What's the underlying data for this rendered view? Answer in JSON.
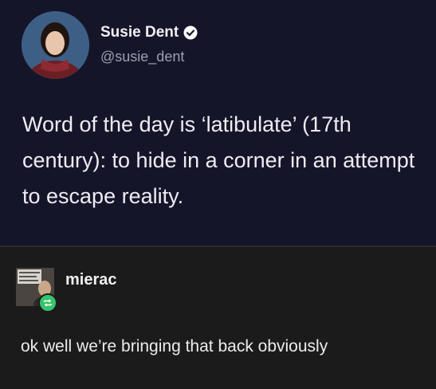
{
  "tweet": {
    "display_name": "Susie Dent",
    "handle": "@susie_dent",
    "text": "Word of the day is ‘latibulate’ (17th century): to hide in a corner in an attempt to escape reality.",
    "verified_icon": "verified-badge-icon"
  },
  "reply": {
    "username": "mierac",
    "text": "ok well we’re bringing that back obviously",
    "reblog_icon": "reblog-icon"
  },
  "colors": {
    "tweet_bg": "#15152a",
    "reply_bg": "#1b1b1c",
    "reblog_green": "#36c46a"
  }
}
